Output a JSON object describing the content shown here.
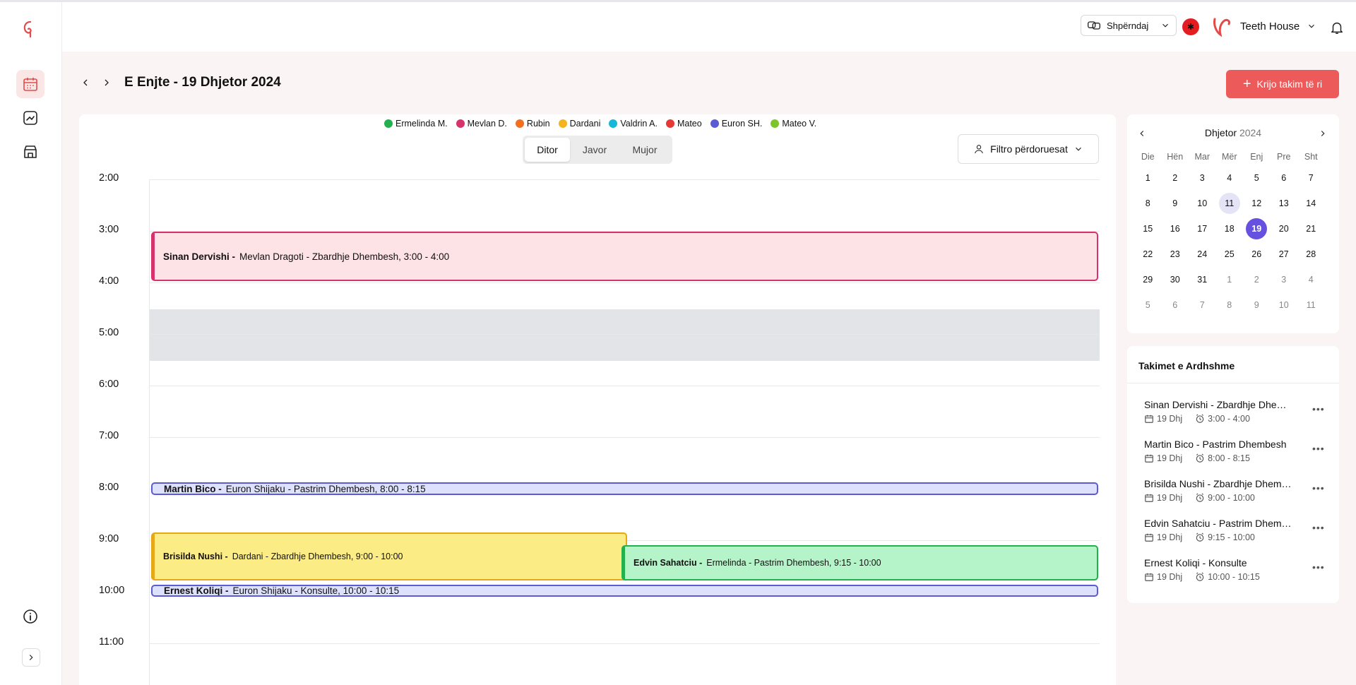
{
  "header": {
    "share_label": "Shpërndaj",
    "clinic_name": "Teeth House"
  },
  "date_heading": "E Enjte - 19 Dhjetor 2024",
  "create_button_label": "Krijo takim të ri",
  "legend": [
    {
      "name": "Ermelinda M.",
      "color": "#22b14c"
    },
    {
      "name": "Mevlan D.",
      "color": "#d6336c"
    },
    {
      "name": "Rubin",
      "color": "#f07020"
    },
    {
      "name": "Dardani",
      "color": "#f2b51d"
    },
    {
      "name": "Valdrin A.",
      "color": "#15b8d6"
    },
    {
      "name": "Mateo",
      "color": "#e53935"
    },
    {
      "name": "Euron SH.",
      "color": "#5b5bd6"
    },
    {
      "name": "Mateo V.",
      "color": "#7cc42a"
    }
  ],
  "view_tabs": [
    "Ditor",
    "Javor",
    "Mujor"
  ],
  "active_view": "Ditor",
  "filter_label": "Filtro përdoruesat",
  "time_labels": [
    "2:00",
    "3:00",
    "4:00",
    "5:00",
    "6:00",
    "7:00",
    "8:00",
    "9:00",
    "10:00",
    "11:00"
  ],
  "events": [
    {
      "patient": "Sinan Dervishi -",
      "details": "Mevlan Dragoti - Zbardhje Dhembesh, 3:00 - 4:00",
      "color": "#d6336c",
      "bg": "#fde2e6"
    },
    {
      "patient": "Martin Bico -",
      "details": "Euron Shijaku - Pastrim Dhembesh, 8:00 - 8:15",
      "color": "#5b5bd6",
      "bg": "#dde1fb"
    },
    {
      "patient": "Brisilda Nushi -",
      "details": "Dardani - Zbardhje Dhembesh, 9:00 - 10:00",
      "color": "#e6a817",
      "bg": "#fcec85"
    },
    {
      "patient": "Edvin Sahatciu -",
      "details": "Ermelinda - Pastrim Dhembesh, 9:15 - 10:00",
      "color": "#22b14c",
      "bg": "#b4f4c8"
    },
    {
      "patient": "Ernest Koliqi -",
      "details": "Euron Shijaku - Konsulte, 10:00 - 10:15",
      "color": "#5b5bd6",
      "bg": "#dde1fb"
    }
  ],
  "mini_calendar": {
    "month": "Dhjetor",
    "year": "2024",
    "weekdays": [
      "Die",
      "Hën",
      "Mar",
      "Mër",
      "Enj",
      "Pre",
      "Sht"
    ],
    "weeks": [
      [
        "1",
        "2",
        "3",
        "4",
        "5",
        "6",
        "7"
      ],
      [
        "8",
        "9",
        "10",
        "11",
        "12",
        "13",
        "14"
      ],
      [
        "15",
        "16",
        "17",
        "18",
        "19",
        "20",
        "21"
      ],
      [
        "22",
        "23",
        "24",
        "25",
        "26",
        "27",
        "28"
      ],
      [
        "29",
        "30",
        "31",
        "1",
        "2",
        "3",
        "4"
      ],
      [
        "5",
        "6",
        "7",
        "8",
        "9",
        "10",
        "11"
      ]
    ],
    "today": "11",
    "selected": "19"
  },
  "upcoming": {
    "title": "Takimet e Ardhshme",
    "items": [
      {
        "name": "Sinan Dervishi - Zbardhje Dhembesh",
        "date": "19 Dhj",
        "time": "3:00 - 4:00"
      },
      {
        "name": "Martin Bico - Pastrim Dhembesh",
        "date": "19 Dhj",
        "time": "8:00 - 8:15"
      },
      {
        "name": "Brisilda Nushi - Zbardhje Dhembesh",
        "date": "19 Dhj",
        "time": "9:00 - 10:00"
      },
      {
        "name": "Edvin Sahatciu - Pastrim Dhembesh",
        "date": "19 Dhj",
        "time": "9:15 - 10:00"
      },
      {
        "name": "Ernest Koliqi - Konsulte",
        "date": "19 Dhj",
        "time": "10:00 - 10:15"
      }
    ]
  },
  "colors": {
    "accent": "#ec5a5a",
    "selected_day": "#6650e0"
  }
}
